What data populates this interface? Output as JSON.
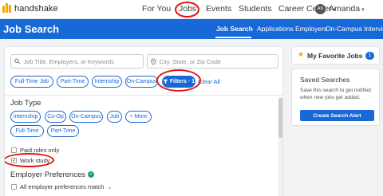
{
  "app": {
    "logo_text": "handshake"
  },
  "topnav": {
    "links": [
      "For You",
      "Jobs",
      "Events",
      "Students",
      "Career Center"
    ],
    "avatar_initials": "AS",
    "user_name": "Amanda"
  },
  "header": {
    "title": "Job Search",
    "tabs": [
      "Job Search",
      "Applications",
      "Employers",
      "On-Campus Interviews"
    ]
  },
  "search": {
    "keyword_placeholder": "Job Title, Employers, or Keywords",
    "location_placeholder": "City, State, or Zip Code"
  },
  "quick_filters": [
    "Full-Time Job",
    "Part-Time",
    "Internship",
    "On-Campus"
  ],
  "filters_button": "Filters · 1",
  "clear_all": "Clear All",
  "job_type": {
    "title": "Job Type",
    "pills_row1": [
      "Internship",
      "Co-Op",
      "On-Campus",
      "Job",
      "+ More"
    ],
    "pills_row2": [
      "Full-Time",
      "Part-Time"
    ]
  },
  "checkboxes": {
    "paid_roles": {
      "label": "Paid roles only",
      "checked": false
    },
    "work_study": {
      "label": "Work study",
      "checked": true
    }
  },
  "employer_prefs": {
    "title": "Employer Preferences",
    "all_match": "All employer preferences match"
  },
  "favorites": {
    "label": "My Favorite Jobs",
    "count": "1"
  },
  "saved_searches": {
    "title": "Saved Searches",
    "description": "Save this search to get notified when new jobs get added.",
    "button": "Create Search Alert"
  },
  "colors": {
    "brand_blue": "#1769d8",
    "annotation_red": "#e3130f",
    "logo_yellow": "#f2a900",
    "check_green": "#19a35c"
  }
}
